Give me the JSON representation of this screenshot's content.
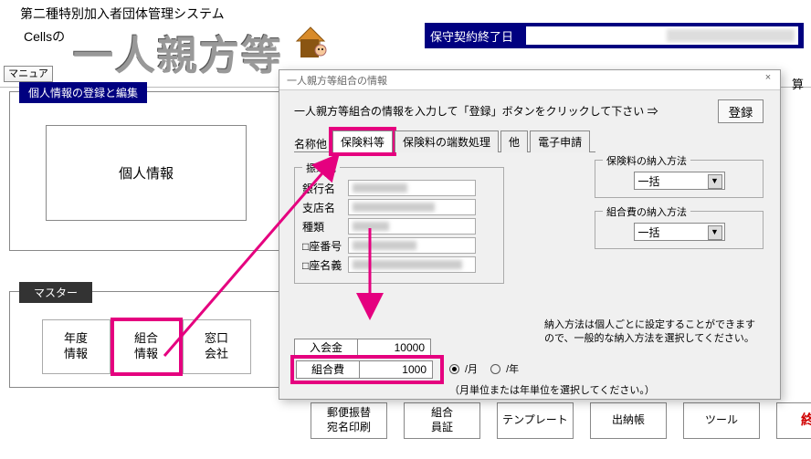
{
  "header": {
    "line1": "第二種特別加入者団体管理システム",
    "line2": "Cellsの",
    "logo": "一人親方等",
    "maintenance_label": "保守契約終了日",
    "manual": "マニュアル"
  },
  "right_hint": "算",
  "left": {
    "panel1_title": "個人情報の登録と編集",
    "personal_info": "個人情報",
    "panel2_title": "マスター",
    "master": {
      "year": "年度\n情報",
      "union": "組合\n情報",
      "madoguchi": "窓口\n会社"
    }
  },
  "bottom": {
    "postal": "郵便振替\n宛名印刷",
    "union_cert": "組合\n員証",
    "template": "テンプレート",
    "ledger": "出納帳",
    "tool": "ツール",
    "exit": "終了"
  },
  "dialog": {
    "title": "一人親方等組合の情報",
    "prompt": "一人親方等組合の情報を入力して「登録」ボタンをクリックして下さい  ⇒",
    "register": "登録",
    "tab_label": "名称他",
    "tabs": {
      "hoken": "保険料等",
      "fraction": "保険料の端数処理",
      "other": "他",
      "eapp": "電子申請"
    },
    "transfer": {
      "legend": "振込先",
      "bank": "銀行名",
      "branch": "支店名",
      "type": "種類",
      "acctno": "□座番号",
      "acctname": "□座名義"
    },
    "method": {
      "hoken_legend": "保険料の納入方法",
      "union_legend": "組合費の納入方法",
      "lump": "一括"
    },
    "note1": "納入方法は個人ごとに設定することができますので、一般的な納入方法を選択してください。",
    "rows": {
      "nyukin": "入会金",
      "nyukin_val": "10000",
      "kumiai": "組合費",
      "kumiai_val": "1000"
    },
    "period": {
      "month": "/月",
      "year": "/年",
      "note": "（月単位または年単位を選択してください。）"
    }
  }
}
